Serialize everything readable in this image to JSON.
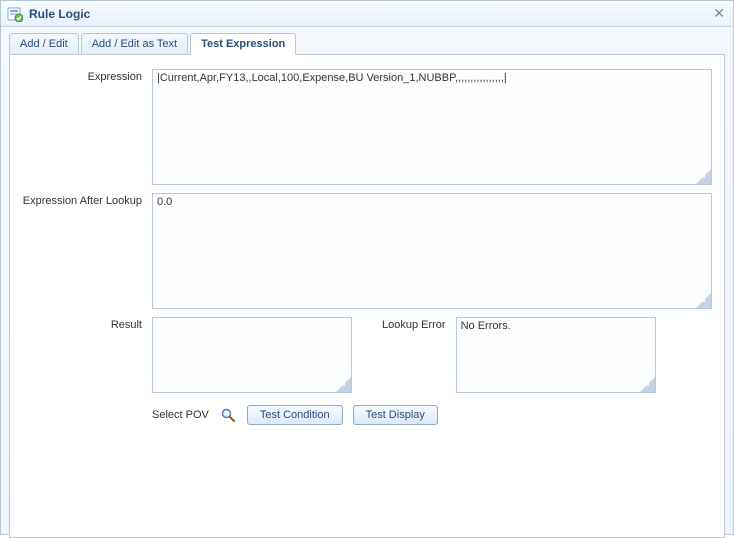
{
  "window": {
    "title": "Rule Logic"
  },
  "tabs": [
    {
      "label": "Add / Edit",
      "active": false
    },
    {
      "label": "Add / Edit as Text",
      "active": false
    },
    {
      "label": "Test Expression",
      "active": true
    }
  ],
  "labels": {
    "expression": "Expression",
    "expression_after_lookup": "Expression After Lookup",
    "result": "Result",
    "lookup_error": "Lookup Error",
    "select_pov": "Select POV"
  },
  "fields": {
    "expression_value": "|Current,Apr,FY13,,Local,100,Expense,BU Version_1,NUBBP,,,,,,,,,,,,,,,,|",
    "expression_placeholder": "",
    "expression_after_lookup_value": "0.0",
    "result_value": "",
    "lookup_error_value": "No Errors."
  },
  "buttons": {
    "test_condition": "Test Condition",
    "test_display": "Test Display"
  }
}
